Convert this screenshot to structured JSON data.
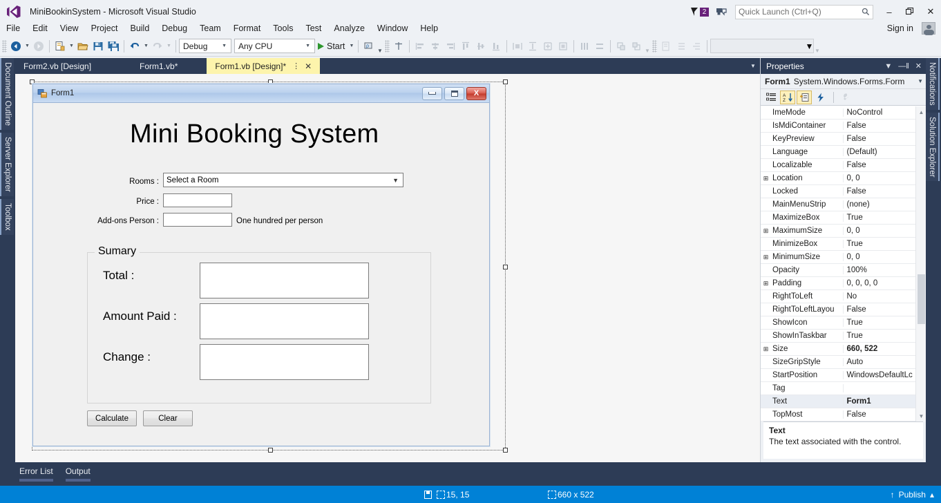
{
  "window": {
    "app_title": "MiniBookinSystem - Microsoft Visual Studio",
    "logo_icon": "visual-studio-logo",
    "minimize_label": "–",
    "restore_label": "❐",
    "close_label": "✕",
    "sign_in_label": "Sign in",
    "account_icon": "account-icon",
    "notification_icon": "notification-flag-icon",
    "notification_count": "2",
    "feedback_icon": "feedback-icon"
  },
  "quick_launch": {
    "placeholder": "Quick Launch (Ctrl+Q)",
    "value": "",
    "search_icon": "search-icon"
  },
  "menu": {
    "items": [
      {
        "label": "File"
      },
      {
        "label": "Edit"
      },
      {
        "label": "View"
      },
      {
        "label": "Project"
      },
      {
        "label": "Build"
      },
      {
        "label": "Debug"
      },
      {
        "label": "Team"
      },
      {
        "label": "Format"
      },
      {
        "label": "Tools"
      },
      {
        "label": "Test"
      },
      {
        "label": "Analyze"
      },
      {
        "label": "Window"
      },
      {
        "label": "Help"
      }
    ]
  },
  "toolbar": {
    "navigate_back_icon": "navigate-back-icon",
    "navigate_forward_icon": "navigate-forward-icon",
    "new_project_icon": "new-project-icon",
    "open_file_icon": "open-file-icon",
    "save_icon": "save-icon",
    "save_all_icon": "save-all-icon",
    "undo_icon": "undo-icon",
    "redo_icon": "redo-icon",
    "config_value": "Debug",
    "platform_value": "Any CPU",
    "start_label": "Start",
    "start_icon": "play-icon",
    "attach_icon": "attach-to-process-icon",
    "align_lefts_icon": "align-lefts-icon",
    "align_centers_icon": "align-centers-icon",
    "align_rights_icon": "align-rights-icon",
    "align_tops_icon": "align-tops-icon",
    "align_middles_icon": "align-middles-icon",
    "align_bottoms_icon": "align-bottoms-icon",
    "make_same_width_icon": "make-same-width-icon",
    "make_same_height_icon": "make-same-height-icon",
    "make_same_size_icon": "make-same-size-icon",
    "size_to_grid_icon": "size-to-grid-icon",
    "horiz_spacing_icon": "horizontal-spacing-icon",
    "vert_spacing_icon": "vertical-spacing-icon",
    "bring_to_front_icon": "bring-to-front-icon",
    "send_to_back_icon": "send-to-back-icon",
    "tab_order_icon": "tab-order-icon",
    "center_horiz_icon": "center-horizontally-icon",
    "center_vert_icon": "center-vertically-icon",
    "overflow_icon": "toolbar-overflow-icon",
    "align_to_grid_icon": "align-to-grid-icon",
    "empty_combo_value": ""
  },
  "left_dock": {
    "tabs": [
      {
        "label": "Document Outline"
      },
      {
        "label": "Server Explorer"
      },
      {
        "label": "Toolbox"
      }
    ]
  },
  "right_dock": {
    "tabs": [
      {
        "label": "Notifications"
      },
      {
        "label": "Solution Explorer"
      }
    ]
  },
  "document_tabs": {
    "items": [
      {
        "label": "Form2.vb [Design]",
        "active": false
      },
      {
        "label": "Form1.vb*",
        "active": false
      },
      {
        "label": "Form1.vb [Design]*",
        "active": true
      }
    ],
    "pin_icon": "pin-icon",
    "close_icon": "close-icon",
    "dropdown_icon": "chevron-down-icon"
  },
  "designer": {
    "form": {
      "title": "Form1",
      "icon": "winform-icon",
      "minimize_icon": "minimize-icon",
      "maximize_icon": "maximize-icon",
      "close_icon": "close-icon",
      "heading": "Mini Booking System",
      "fields": [
        {
          "label": "Rooms :",
          "type": "combobox",
          "value": "Select a Room"
        },
        {
          "label": "Price :",
          "type": "textbox",
          "value": ""
        },
        {
          "label": "Add-ons Person :",
          "type": "textbox",
          "value": "",
          "note": "One hundred per person"
        }
      ],
      "group": {
        "title": "Sumary",
        "rows": [
          {
            "label": "Total :",
            "value": ""
          },
          {
            "label": "Amount Paid :",
            "value": ""
          },
          {
            "label": "Change :",
            "value": ""
          }
        ]
      },
      "buttons": [
        {
          "label": "Calculate"
        },
        {
          "label": "Clear"
        }
      ]
    }
  },
  "properties": {
    "panel_title": "Properties",
    "dropdown_icon": "chevron-down-icon",
    "pin_icon": "pin-icon",
    "close_icon": "close-icon",
    "object_name": "Form1",
    "object_type": "System.Windows.Forms.Form",
    "tools": {
      "categorized_icon": "categorized-view-icon",
      "alphabetical_icon": "alphabetical-sort-icon",
      "properties_icon": "properties-page-icon",
      "events_icon": "events-lightning-icon",
      "property_pages_icon": "property-pages-wrench-icon"
    },
    "rows": [
      {
        "expand": false,
        "name": "ImeMode",
        "value": "NoControl",
        "bold": false
      },
      {
        "expand": false,
        "name": "IsMdiContainer",
        "value": "False",
        "bold": false
      },
      {
        "expand": false,
        "name": "KeyPreview",
        "value": "False",
        "bold": false
      },
      {
        "expand": false,
        "name": "Language",
        "value": "(Default)",
        "bold": false
      },
      {
        "expand": false,
        "name": "Localizable",
        "value": "False",
        "bold": false
      },
      {
        "expand": true,
        "name": "Location",
        "value": "0, 0",
        "bold": false
      },
      {
        "expand": false,
        "name": "Locked",
        "value": "False",
        "bold": false
      },
      {
        "expand": false,
        "name": "MainMenuStrip",
        "value": "(none)",
        "bold": false
      },
      {
        "expand": false,
        "name": "MaximizeBox",
        "value": "True",
        "bold": false
      },
      {
        "expand": true,
        "name": "MaximumSize",
        "value": "0, 0",
        "bold": false
      },
      {
        "expand": false,
        "name": "MinimizeBox",
        "value": "True",
        "bold": false
      },
      {
        "expand": true,
        "name": "MinimumSize",
        "value": "0, 0",
        "bold": false
      },
      {
        "expand": false,
        "name": "Opacity",
        "value": "100%",
        "bold": false
      },
      {
        "expand": true,
        "name": "Padding",
        "value": "0, 0, 0, 0",
        "bold": false
      },
      {
        "expand": false,
        "name": "RightToLeft",
        "value": "No",
        "bold": false
      },
      {
        "expand": false,
        "name": "RightToLeftLayou",
        "value": "False",
        "bold": false
      },
      {
        "expand": false,
        "name": "ShowIcon",
        "value": "True",
        "bold": false
      },
      {
        "expand": false,
        "name": "ShowInTaskbar",
        "value": "True",
        "bold": false
      },
      {
        "expand": true,
        "name": "Size",
        "value": "660, 522",
        "bold": true
      },
      {
        "expand": false,
        "name": "SizeGripStyle",
        "value": "Auto",
        "bold": false
      },
      {
        "expand": false,
        "name": "StartPosition",
        "value": "WindowsDefaultLc",
        "bold": false
      },
      {
        "expand": false,
        "name": "Tag",
        "value": "",
        "bold": false
      },
      {
        "expand": false,
        "name": "Text",
        "value": "Form1",
        "bold": true,
        "selected": true
      },
      {
        "expand": false,
        "name": "TopMost",
        "value": "False",
        "bold": false
      }
    ],
    "description": {
      "title": "Text",
      "text": "The text associated with the control."
    },
    "scroll_up_icon": "scroll-up-arrow",
    "scroll_down_icon": "scroll-down-arrow"
  },
  "bottom_tabs": {
    "items": [
      {
        "label": "Error List"
      },
      {
        "label": "Output"
      }
    ]
  },
  "status_bar": {
    "save_icon": "save-state-icon",
    "position_icon": "position-icon",
    "position": "15, 15",
    "size_icon": "size-icon",
    "size": "660 x 522",
    "publish_icon": "publish-up-arrow-icon",
    "publish_label": "Publish",
    "publish_chevron": "▴"
  },
  "colors": {
    "accent_blue": "#0081d6",
    "chrome": "#eef1f5",
    "dock_navy": "#2d3c56",
    "active_tab_yellow": "#fdf4ac",
    "badge_purple": "#68217a",
    "start_green": "#2e962e"
  }
}
